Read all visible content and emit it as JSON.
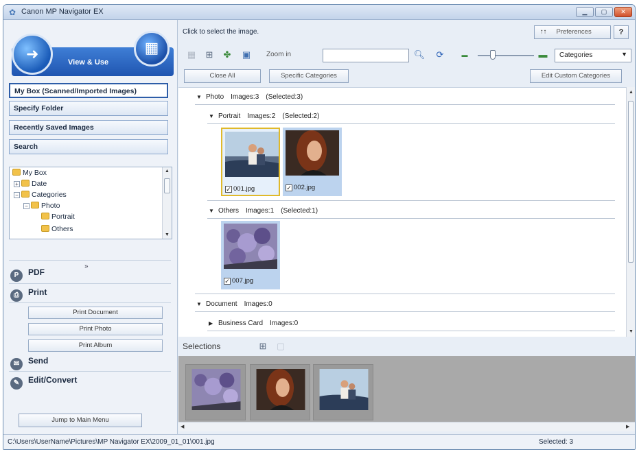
{
  "window": {
    "title": "Canon MP Navigator EX"
  },
  "mode": {
    "label": "View & Use"
  },
  "nav": [
    {
      "label": "My Box (Scanned/Imported Images)",
      "active": true
    },
    {
      "label": "Specify Folder"
    },
    {
      "label": "Recently Saved Images"
    },
    {
      "label": "Search"
    }
  ],
  "tree": {
    "root": "My Box",
    "items": [
      "Date",
      "Categories",
      "Photo",
      "Portrait",
      "Others"
    ]
  },
  "actions": {
    "pdf": "PDF",
    "print": "Print",
    "print_document": "Print Document",
    "print_photo": "Print Photo",
    "print_album": "Print Album",
    "send": "Send",
    "edit_convert": "Edit/Convert"
  },
  "jump_label": "Jump to Main Menu",
  "hint": "Click to select the image.",
  "preferences_label": "Preferences",
  "help_label": "?",
  "zoom_label": "Zoom in",
  "search_value": "",
  "category_select": "Categories",
  "buttons": {
    "close_all": "Close All",
    "specific_categories": "Specific Categories",
    "edit_custom_categories": "Edit Custom Categories"
  },
  "groups": {
    "photo": {
      "name": "Photo",
      "images": "Images:3",
      "selected": "(Selected:3)"
    },
    "portrait": {
      "name": "Portrait",
      "images": "Images:2",
      "selected": "(Selected:2)"
    },
    "others": {
      "name": "Others",
      "images": "Images:1",
      "selected": "(Selected:1)"
    },
    "document": {
      "name": "Document",
      "images": "Images:0"
    },
    "business_card": {
      "name": "Business Card",
      "images": "Images:0"
    }
  },
  "thumbs": {
    "t1": "001.jpg",
    "t2": "002.jpg",
    "t3": "007.jpg"
  },
  "selections_label": "Selections",
  "status": {
    "path": "C:\\Users\\UserName\\Pictures\\MP Navigator EX\\2009_01_01\\001.jpg",
    "selected": "Selected: 3"
  }
}
